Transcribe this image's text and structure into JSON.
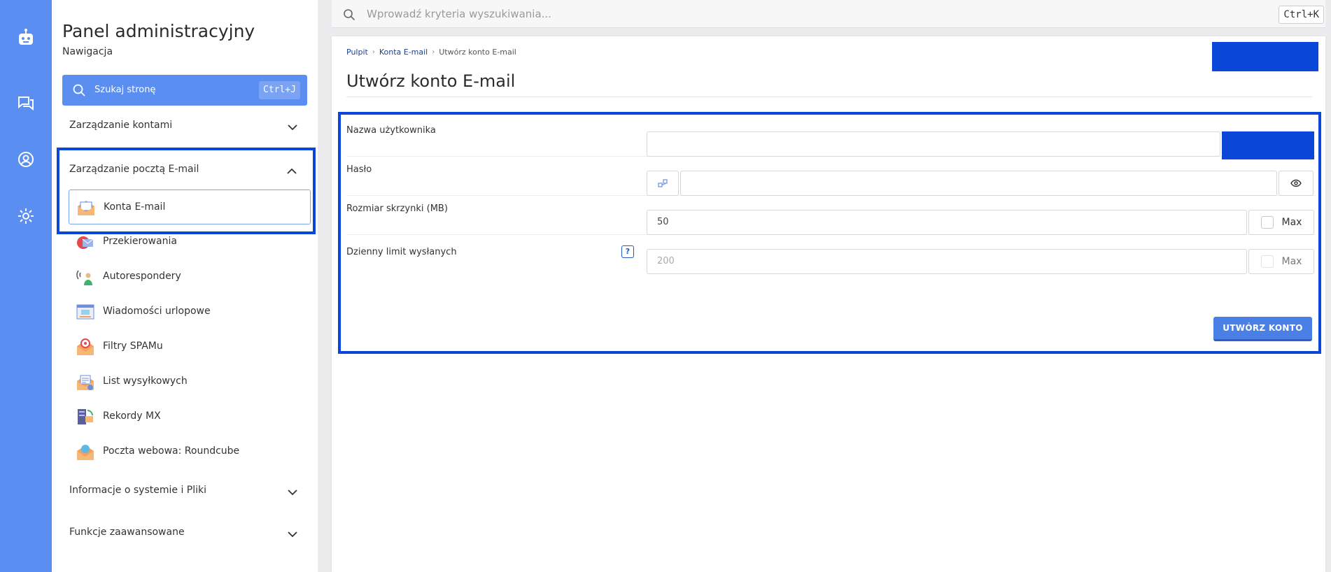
{
  "rail": {
    "icons": [
      "robot-icon",
      "chat-icon",
      "user-icon",
      "settings-icon"
    ]
  },
  "sidebar": {
    "title": "Panel administracyjny",
    "subtitle": "Nawigacja",
    "search": {
      "label": "Szukaj stronę",
      "shortcut": "Ctrl+J"
    },
    "sections": [
      {
        "label": "Zarządzanie kontami"
      },
      {
        "label": "Zarządzanie pocztą E-mail"
      },
      {
        "label": "Informacje o systemie i Pliki"
      },
      {
        "label": "Funkcje zaawansowane"
      }
    ],
    "items": [
      {
        "label": "Konta E-mail",
        "icon": "mail-open-icon"
      },
      {
        "label": "Przekierowania",
        "icon": "forward-icon"
      },
      {
        "label": "Autorespondery",
        "icon": "autoresponder-icon"
      },
      {
        "label": "Wiadomości urlopowe",
        "icon": "vacation-message-icon"
      },
      {
        "label": "Filtry SPAMu",
        "icon": "spam-filter-icon"
      },
      {
        "label": "List wysyłkowych",
        "icon": "mailing-list-icon"
      },
      {
        "label": "Rekordy MX",
        "icon": "mx-record-icon"
      },
      {
        "label": "Poczta webowa: Roundcube",
        "icon": "roundcube-icon"
      }
    ]
  },
  "topbar": {
    "placeholder": "Wprowadź kryteria wyszukiwania...",
    "shortcut": "Ctrl+K"
  },
  "breadcrumb": [
    "Pulpit",
    "Konta E-mail",
    "Utwórz konto E-mail"
  ],
  "page_title": "Utwórz konto E-mail",
  "form": {
    "username_label": "Nazwa użytkownika",
    "username_value": "",
    "password_label": "Hasło",
    "password_value": "",
    "quota_label": "Rozmiar skrzynki (MB)",
    "quota_value": "50",
    "quota_max_label": "Max",
    "limit_label": "Dzienny limit wysłanych",
    "limit_help": "?",
    "limit_value": "200",
    "limit_max_label": "Max",
    "submit_label": "UTWÓRZ KONTO"
  },
  "colors": {
    "accent": "#5b8ef1",
    "highlight": "#0a47d8",
    "button": "#4a7fe6"
  }
}
